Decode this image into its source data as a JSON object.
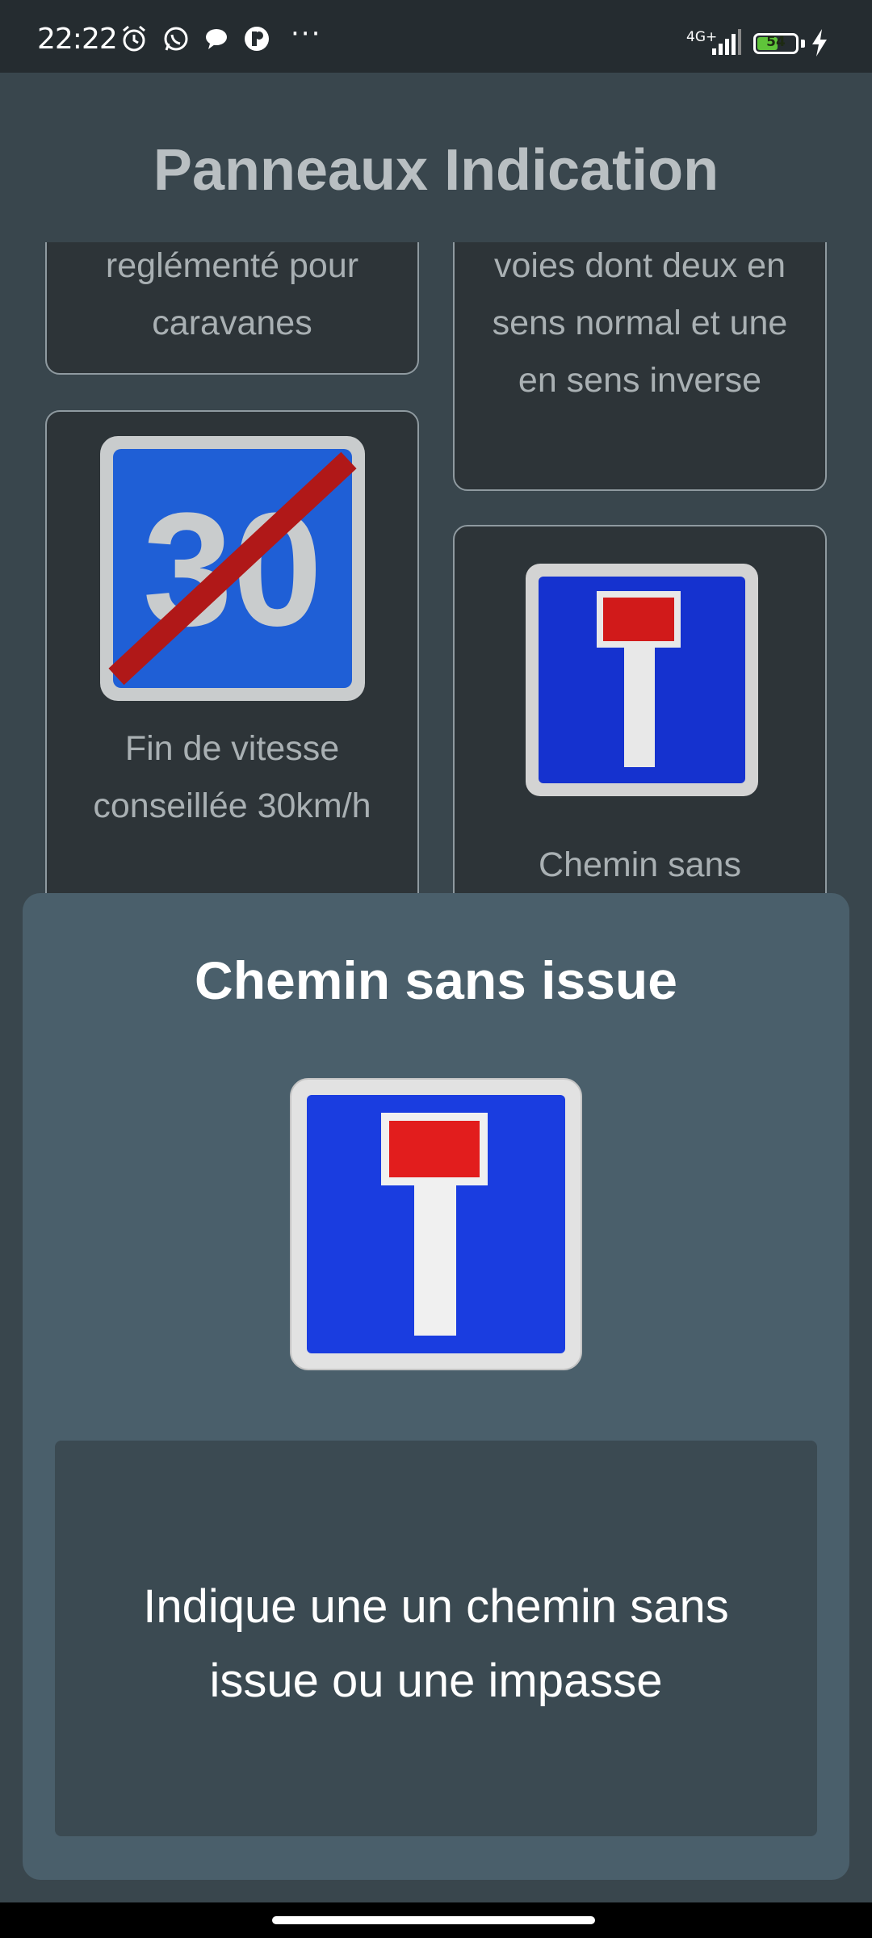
{
  "status_bar": {
    "time": "22:22",
    "network": "4G+",
    "battery_level": "54",
    "battery_fraction": 0.54,
    "icons": [
      "alarm-icon",
      "whatsapp-icon",
      "message-icon",
      "app-icon",
      "more-icon",
      "signal-icon",
      "battery-icon",
      "charging-icon"
    ],
    "more": "···"
  },
  "page": {
    "title": "Panneaux Indication",
    "cards": [
      {
        "label": "reglémenté pour caravanes"
      },
      {
        "label": "voies dont deux en sens normal et une en sens inverse"
      },
      {
        "label": "Fin de vitesse conseillée 30km/h",
        "sign_number": "30"
      },
      {
        "label": "Chemin sans"
      }
    ]
  },
  "sheet": {
    "title": "Chemin sans issue",
    "description": "Indique une un chemin sans issue ou une impasse"
  },
  "colors": {
    "sign_blue": "#1a3de0",
    "sign_red": "#e21d1d",
    "sheet_bg": "#4a5f6b"
  }
}
